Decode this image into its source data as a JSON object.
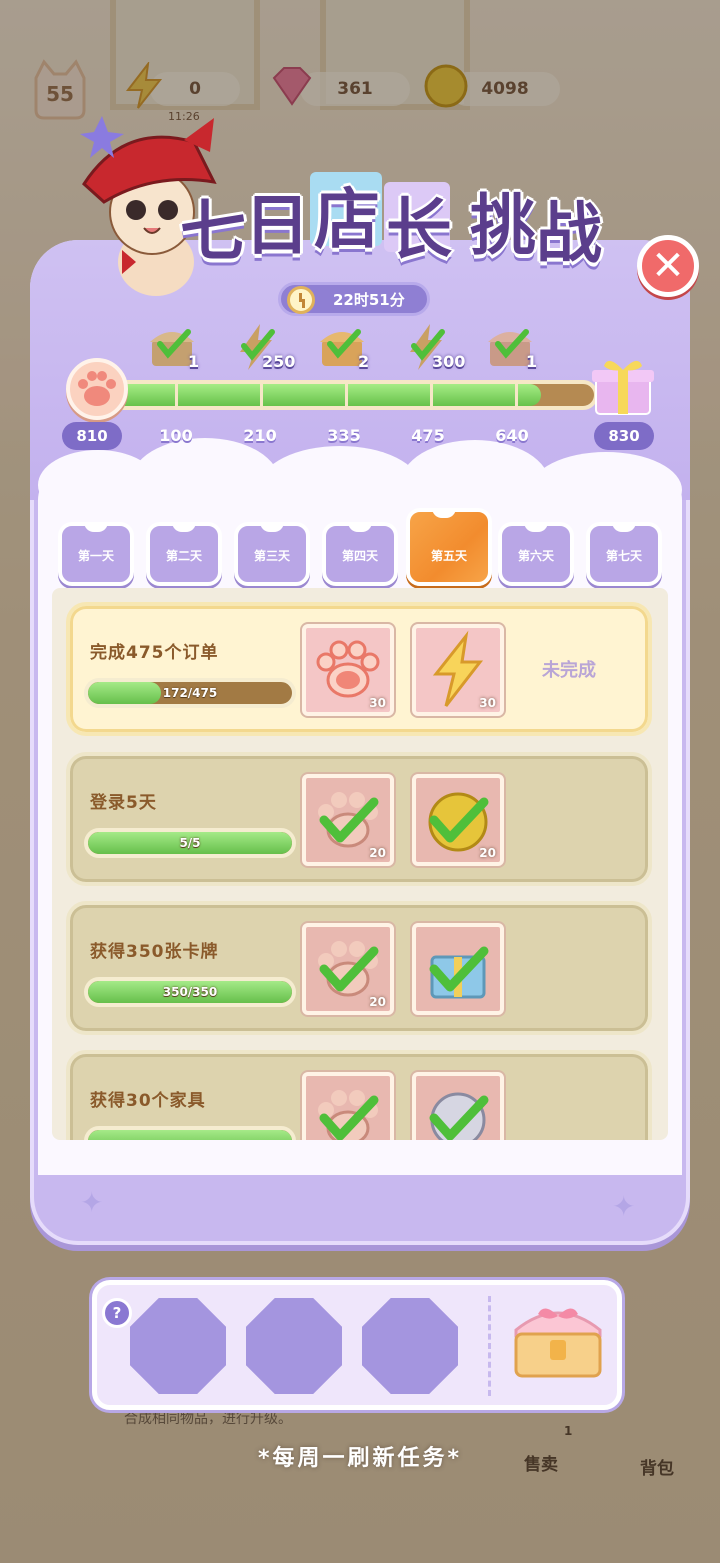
{
  "hud": {
    "level": "55",
    "energy": "0",
    "energy_timer": "11:26",
    "gems": "361",
    "coins": "4098"
  },
  "event": {
    "title_chars": [
      "七",
      "日",
      "店",
      "长",
      "挑",
      "战"
    ],
    "timer": "22时51分",
    "close_icon": "close-icon",
    "current_points": "810",
    "goal_points": "830",
    "progress_fraction": 0.89,
    "milestones": [
      {
        "points": "100",
        "reward": "chest",
        "count": "1",
        "claimed": true
      },
      {
        "points": "210",
        "reward": "energy",
        "count": "250",
        "claimed": true
      },
      {
        "points": "335",
        "reward": "chest",
        "count": "2",
        "claimed": true
      },
      {
        "points": "475",
        "reward": "energy",
        "count": "300",
        "claimed": true
      },
      {
        "points": "640",
        "reward": "chest",
        "count": "1",
        "claimed": true
      }
    ]
  },
  "tabs": [
    {
      "label": "第一天",
      "active": false
    },
    {
      "label": "第二天",
      "active": false
    },
    {
      "label": "第三天",
      "active": false
    },
    {
      "label": "第四天",
      "active": false
    },
    {
      "label": "第五天",
      "active": true
    },
    {
      "label": "第六天",
      "active": false
    },
    {
      "label": "第七天",
      "active": false
    }
  ],
  "tasks": [
    {
      "title": "完成475个订单",
      "progress_text": "172/475",
      "progress_fraction": 0.36,
      "status": "未完成",
      "rewards": [
        {
          "icon": "paw-icon",
          "count": "30",
          "claimed": false
        },
        {
          "icon": "energy-bolt-icon",
          "count": "30",
          "claimed": false
        }
      ]
    },
    {
      "title": "登录5天",
      "progress_text": "5/5",
      "progress_fraction": 1,
      "status": "",
      "rewards": [
        {
          "icon": "paw-icon",
          "count": "20",
          "claimed": true
        },
        {
          "icon": "coin-icon",
          "count": "20",
          "claimed": true
        }
      ]
    },
    {
      "title": "获得350张卡牌",
      "progress_text": "350/350",
      "progress_fraction": 1,
      "status": "",
      "rewards": [
        {
          "icon": "paw-icon",
          "count": "20",
          "claimed": true
        },
        {
          "icon": "gift-box-icon",
          "count": "",
          "claimed": true
        }
      ]
    },
    {
      "title": "获得30个家具",
      "progress_text": "",
      "progress_fraction": 1,
      "status": "",
      "rewards": [
        {
          "icon": "paw-icon",
          "count": "",
          "claimed": true
        },
        {
          "icon": "silver-coin-icon",
          "count": "",
          "claimed": true
        }
      ]
    }
  ],
  "bottom": {
    "help": "?",
    "slots": 3,
    "refresh_text": "*每周一刷新任务*",
    "hint_text": "合成相同物品，进行升级。",
    "sell_label": "售卖",
    "bag_label": "背包",
    "sell_count": "1"
  },
  "colors": {
    "panel": "#c8b8ef",
    "accent_orange": "#f28c2e",
    "progress_green": "#67c24a",
    "title_purple": "#5b3e8c"
  }
}
